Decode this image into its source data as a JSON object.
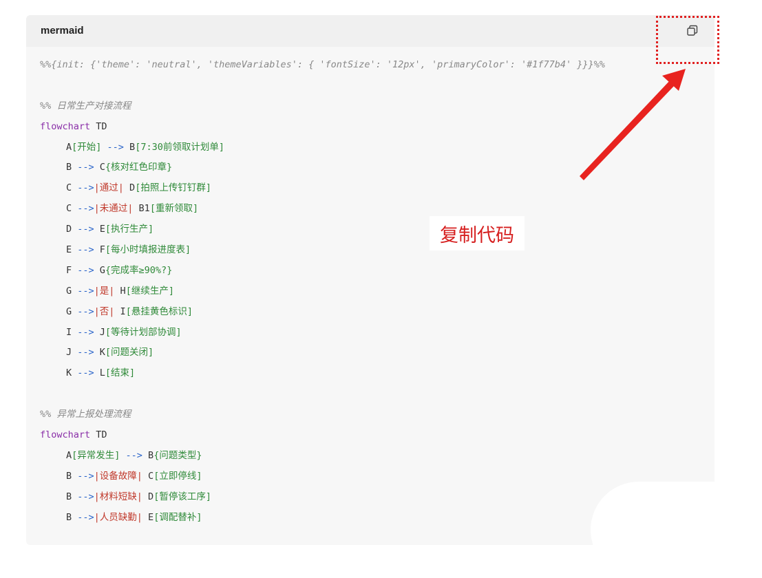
{
  "code_block": {
    "language": "mermaid",
    "copy_button": {
      "icon": "copy-icon"
    },
    "lines": [
      [
        {
          "t": "%%{init: {'theme': 'neutral', 'themeVariables': { 'fontSize': '12px', 'primaryColor': '#1f77b4' }}}%%",
          "c": "cmt"
        }
      ],
      [],
      [
        {
          "t": "%% 日常生产对接流程",
          "c": "cmt"
        }
      ],
      [
        {
          "t": "flowchart",
          "c": "kw"
        },
        {
          "t": " TD",
          "c": "txt"
        }
      ],
      [
        {
          "t": "A",
          "c": "node"
        },
        {
          "t": "[开始]",
          "c": "bracket"
        },
        {
          "t": " --> ",
          "c": "arrow"
        },
        {
          "t": "B",
          "c": "node"
        },
        {
          "t": "[7:30前领取计划单]",
          "c": "bracket"
        }
      ],
      [
        {
          "t": "B",
          "c": "node"
        },
        {
          "t": " --> ",
          "c": "arrow"
        },
        {
          "t": "C",
          "c": "node"
        },
        {
          "t": "{核对红色印章}",
          "c": "bracket"
        }
      ],
      [
        {
          "t": "C",
          "c": "node"
        },
        {
          "t": " -->",
          "c": "arrow"
        },
        {
          "t": "|通过| ",
          "c": "edge"
        },
        {
          "t": "D",
          "c": "node"
        },
        {
          "t": "[拍照上传钉钉群]",
          "c": "bracket"
        }
      ],
      [
        {
          "t": "C",
          "c": "node"
        },
        {
          "t": " -->",
          "c": "arrow"
        },
        {
          "t": "|未通过| ",
          "c": "edge"
        },
        {
          "t": "B1",
          "c": "node"
        },
        {
          "t": "[重新领取]",
          "c": "bracket"
        }
      ],
      [
        {
          "t": "D",
          "c": "node"
        },
        {
          "t": " --> ",
          "c": "arrow"
        },
        {
          "t": "E",
          "c": "node"
        },
        {
          "t": "[执行生产]",
          "c": "bracket"
        }
      ],
      [
        {
          "t": "E",
          "c": "node"
        },
        {
          "t": " --> ",
          "c": "arrow"
        },
        {
          "t": "F",
          "c": "node"
        },
        {
          "t": "[每小时填报进度表]",
          "c": "bracket"
        }
      ],
      [
        {
          "t": "F",
          "c": "node"
        },
        {
          "t": " --> ",
          "c": "arrow"
        },
        {
          "t": "G",
          "c": "node"
        },
        {
          "t": "{完成率≥90%?}",
          "c": "bracket"
        }
      ],
      [
        {
          "t": "G",
          "c": "node"
        },
        {
          "t": " -->",
          "c": "arrow"
        },
        {
          "t": "|是| ",
          "c": "edge"
        },
        {
          "t": "H",
          "c": "node"
        },
        {
          "t": "[继续生产]",
          "c": "bracket"
        }
      ],
      [
        {
          "t": "G",
          "c": "node"
        },
        {
          "t": " -->",
          "c": "arrow"
        },
        {
          "t": "|否| ",
          "c": "edge"
        },
        {
          "t": "I",
          "c": "node"
        },
        {
          "t": "[悬挂黄色标识]",
          "c": "bracket"
        }
      ],
      [
        {
          "t": "I",
          "c": "node"
        },
        {
          "t": " --> ",
          "c": "arrow"
        },
        {
          "t": "J",
          "c": "node"
        },
        {
          "t": "[等待计划部协调]",
          "c": "bracket"
        }
      ],
      [
        {
          "t": "J",
          "c": "node"
        },
        {
          "t": " --> ",
          "c": "arrow"
        },
        {
          "t": "K",
          "c": "node"
        },
        {
          "t": "[问题关闭]",
          "c": "bracket"
        }
      ],
      [
        {
          "t": "K",
          "c": "node"
        },
        {
          "t": " --> ",
          "c": "arrow"
        },
        {
          "t": "L",
          "c": "node"
        },
        {
          "t": "[结束]",
          "c": "bracket"
        }
      ],
      [],
      [
        {
          "t": "%% 异常上报处理流程",
          "c": "cmt"
        }
      ],
      [
        {
          "t": "flowchart",
          "c": "kw"
        },
        {
          "t": " TD",
          "c": "txt"
        }
      ],
      [
        {
          "t": "A",
          "c": "node"
        },
        {
          "t": "[异常发生]",
          "c": "bracket"
        },
        {
          "t": " --> ",
          "c": "arrow"
        },
        {
          "t": "B",
          "c": "node"
        },
        {
          "t": "{问题类型}",
          "c": "bracket"
        }
      ],
      [
        {
          "t": "B",
          "c": "node"
        },
        {
          "t": " -->",
          "c": "arrow"
        },
        {
          "t": "|设备故障| ",
          "c": "edge"
        },
        {
          "t": "C",
          "c": "node"
        },
        {
          "t": "[立即停线]",
          "c": "bracket"
        }
      ],
      [
        {
          "t": "B",
          "c": "node"
        },
        {
          "t": " -->",
          "c": "arrow"
        },
        {
          "t": "|材料短缺| ",
          "c": "edge"
        },
        {
          "t": "D",
          "c": "node"
        },
        {
          "t": "[暂停该工序]",
          "c": "bracket"
        }
      ],
      [
        {
          "t": "B",
          "c": "node"
        },
        {
          "t": " -->",
          "c": "arrow"
        },
        {
          "t": "|人员缺勤| ",
          "c": "edge"
        },
        {
          "t": "E",
          "c": "node"
        },
        {
          "t": "[调配替补]",
          "c": "bracket"
        }
      ]
    ],
    "indented_lines": [
      4,
      5,
      6,
      7,
      8,
      9,
      10,
      11,
      12,
      13,
      14,
      15,
      19,
      20,
      21,
      22
    ]
  },
  "annotation": {
    "label": "复制代码",
    "color": "#e02020"
  }
}
